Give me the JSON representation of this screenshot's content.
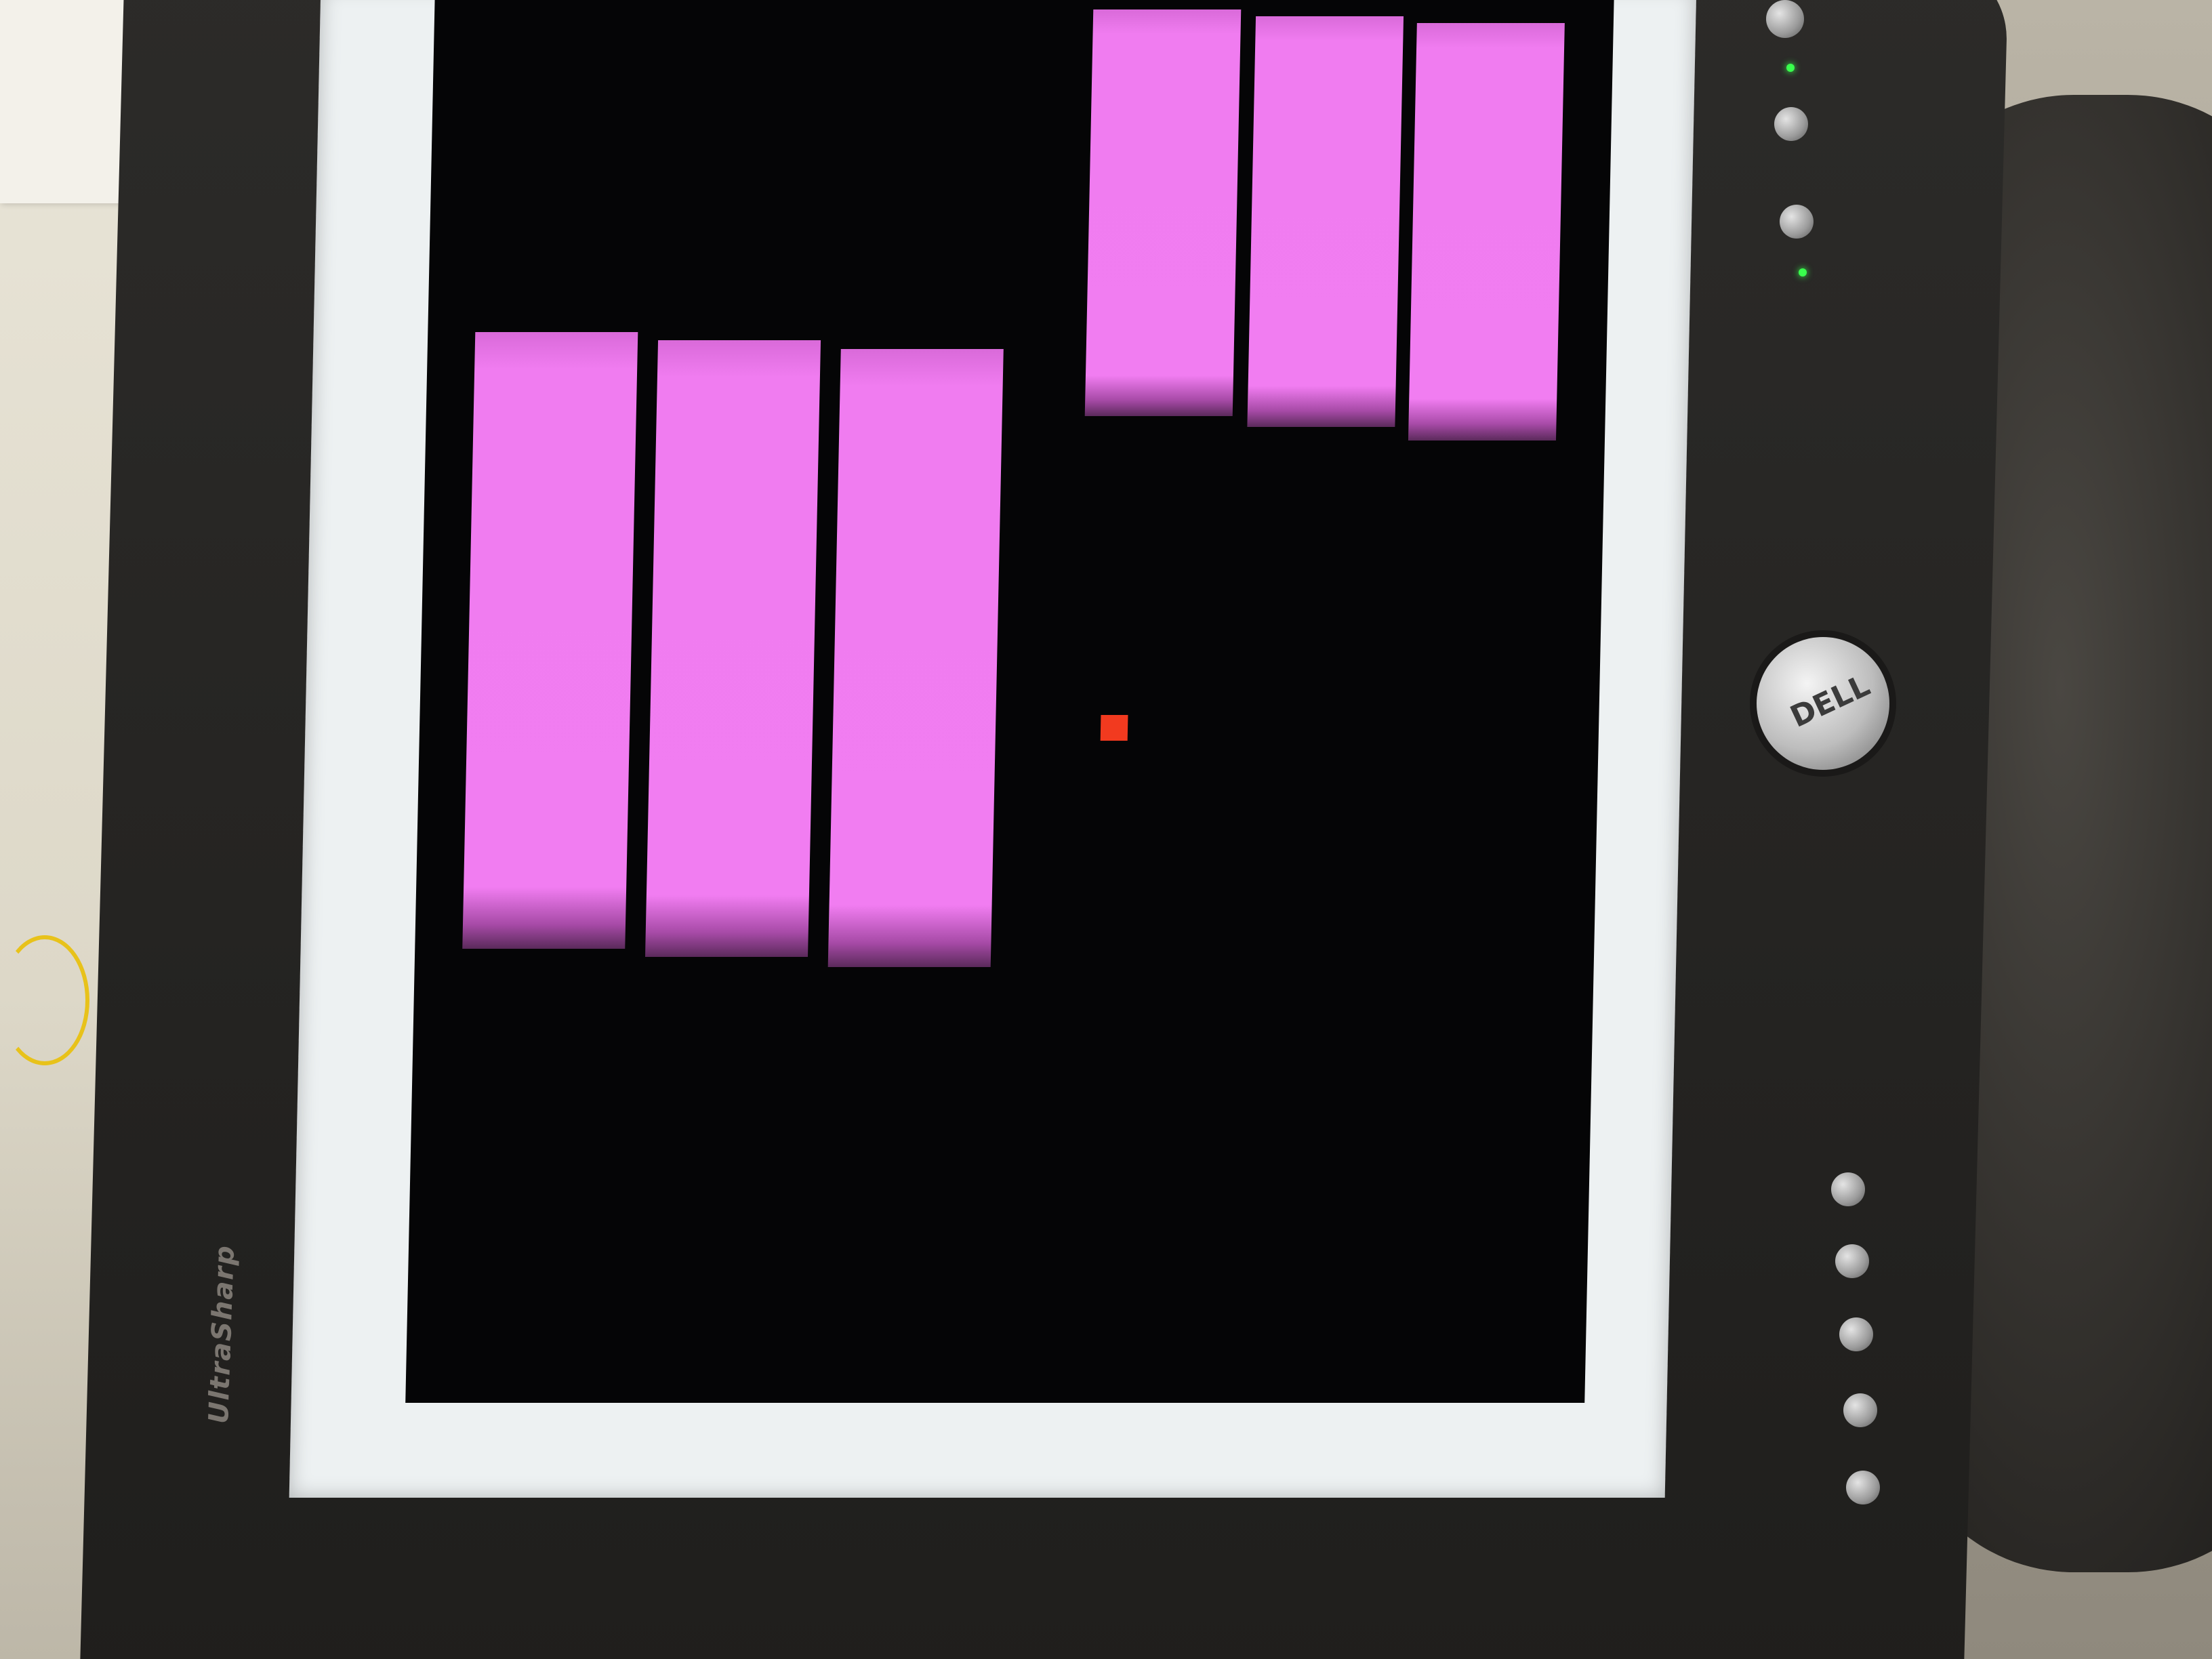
{
  "brand": {
    "model_label": "UltraSharp",
    "logo_label": "DELL"
  },
  "colors": {
    "screen_background": "#050506",
    "bar_fill": "#f17df1",
    "target_fill": "#f23a1f",
    "frame_white": "#edf1f2",
    "bezel": "#1f1e1c"
  },
  "icons": [
    "power-button-icon",
    "control-button-icon",
    "status-led-icon",
    "dell-logo-icon"
  ]
}
